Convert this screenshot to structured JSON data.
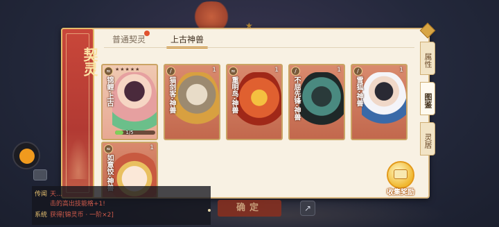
{
  "panel": {
    "title": "契灵",
    "tabs": [
      {
        "label": "普通契灵",
        "has_dot": true
      },
      {
        "label": "上古神兽",
        "active": true
      }
    ],
    "side_tabs": [
      {
        "label": "属性"
      },
      {
        "label": "图鉴",
        "active": true
      },
      {
        "label": "灵居"
      }
    ],
    "cards": [
      {
        "name": "锦鲤·上古",
        "count": "",
        "stars": "★★★★★",
        "progress": "1/5",
        "progress_fraction": 0.2,
        "owned": true
      },
      {
        "name": "猫剑客·神兽",
        "count": "1"
      },
      {
        "name": "重明鸟·神兽",
        "count": "1"
      },
      {
        "name": "不屈先锋·神兽",
        "count": "1"
      },
      {
        "name": "雪狐·神兽",
        "count": "1"
      },
      {
        "name": "如意饺·神兽",
        "count": "1"
      }
    ],
    "reward_label": "收集奖励"
  },
  "chat": {
    "lines": [
      {
        "tag": "传闻",
        "text": "天..."
      },
      {
        "tag": "",
        "text": "击的高出技能格+1!"
      },
      {
        "tag": "系统",
        "text": "获得[锦灵币 · 一阶×2]"
      }
    ]
  },
  "bottom": {
    "confirm_label": "确定",
    "share_icon": "share-icon"
  },
  "colors": {
    "panel_bg": "#f8f1e3",
    "title_strip": "#b23a33",
    "accent": "#c98a2a",
    "card_bg": "#c2684d"
  }
}
